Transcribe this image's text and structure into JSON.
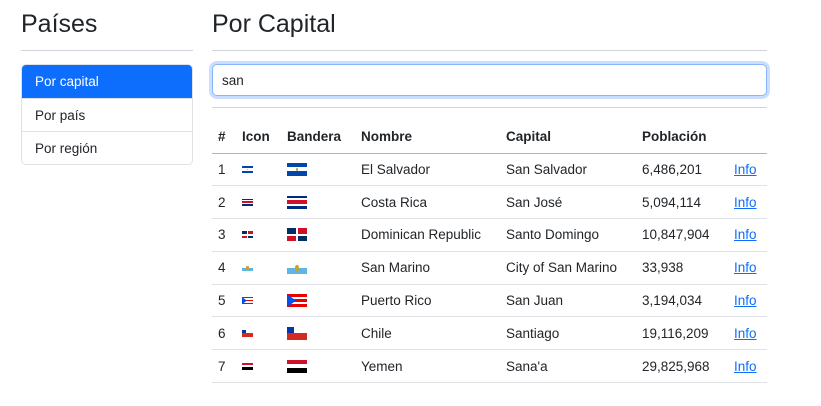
{
  "sidebar": {
    "title": "Países",
    "items": [
      {
        "label": "Por capital",
        "active": true
      },
      {
        "label": "Por país",
        "active": false
      },
      {
        "label": "Por región",
        "active": false
      }
    ]
  },
  "main": {
    "title": "Por Capital",
    "search": {
      "value": "san",
      "placeholder": ""
    },
    "table": {
      "headers": [
        "#",
        "Icon",
        "Bandera",
        "Nombre",
        "Capital",
        "Población",
        ""
      ],
      "rows": [
        {
          "num": "1",
          "name": "El Salvador",
          "capital": "San Salvador",
          "population": "6,486,201",
          "link": "Info",
          "flag": {
            "type": "h3",
            "colors": [
              "#0047ab",
              "#ffffff",
              "#0047ab"
            ],
            "emblem": "#c9a227"
          }
        },
        {
          "num": "2",
          "name": "Costa Rica",
          "capital": "San José",
          "population": "5,094,114",
          "link": "Info",
          "flag": {
            "type": "cr",
            "colors": [
              "#002b7f",
              "#ffffff",
              "#ce1126",
              "#ffffff",
              "#002b7f"
            ]
          }
        },
        {
          "num": "3",
          "name": "Dominican Republic",
          "capital": "Santo Domingo",
          "population": "10,847,904",
          "link": "Info",
          "flag": {
            "type": "do",
            "colors": [
              "#002d62",
              "#ce1126",
              "#ffffff"
            ]
          }
        },
        {
          "num": "4",
          "name": "San Marino",
          "capital": "City of San Marino",
          "population": "33,938",
          "link": "Info",
          "flag": {
            "type": "h2",
            "colors": [
              "#ffffff",
              "#5eb6e4"
            ],
            "emblem": "#c9a227"
          }
        },
        {
          "num": "5",
          "name": "Puerto Rico",
          "capital": "San Juan",
          "population": "3,194,034",
          "link": "Info",
          "flag": {
            "type": "pr",
            "colors": [
              "#ed0000",
              "#ffffff",
              "#0050f0"
            ]
          }
        },
        {
          "num": "6",
          "name": "Chile",
          "capital": "Santiago",
          "population": "19,116,209",
          "link": "Info",
          "flag": {
            "type": "cl",
            "colors": [
              "#ffffff",
              "#d52b1e",
              "#0039a6"
            ]
          }
        },
        {
          "num": "7",
          "name": "Yemen",
          "capital": "Sana'a",
          "population": "29,825,968",
          "link": "Info",
          "flag": {
            "type": "h3",
            "colors": [
              "#ce1126",
              "#ffffff",
              "#000000"
            ]
          }
        }
      ]
    }
  }
}
